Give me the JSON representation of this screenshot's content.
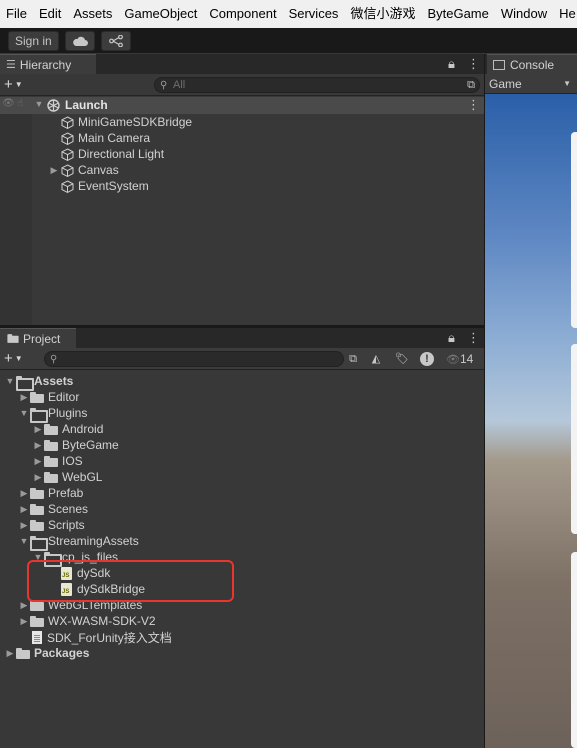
{
  "menu": [
    "File",
    "Edit",
    "Assets",
    "GameObject",
    "Component",
    "Services",
    "微信小游戏",
    "ByteGame",
    "Window",
    "He"
  ],
  "toolbar": {
    "signin": "Sign in",
    "cloud_icon": "cloud-icon",
    "collab_icon": "collab-icon"
  },
  "hierarchy": {
    "tab": "Hierarchy",
    "search_placeholder": "All",
    "scene": "Launch",
    "items": [
      {
        "label": "MiniGameSDKBridge",
        "has_children": false
      },
      {
        "label": "Main Camera",
        "has_children": false
      },
      {
        "label": "Directional Light",
        "has_children": false
      },
      {
        "label": "Canvas",
        "has_children": true
      },
      {
        "label": "EventSystem",
        "has_children": false
      }
    ]
  },
  "project": {
    "tab": "Project",
    "hidden_count": "14",
    "tree": {
      "assets": "Assets",
      "editor": "Editor",
      "plugins": "Plugins",
      "android": "Android",
      "bytegame": "ByteGame",
      "ios": "IOS",
      "webgl": "WebGL",
      "prefab": "Prefab",
      "scenes": "Scenes",
      "scripts": "Scripts",
      "streaming": "StreamingAssets",
      "cp_files": "cp_js_files",
      "dysdk": "dySdk",
      "dysdkbridge": "dySdkBridge",
      "webgltemplates": "WebGLTemplates",
      "wxsdk": "WX-WASM-SDK-V2",
      "doc": "SDK_ForUnity接入文档",
      "packages": "Packages"
    }
  },
  "right": {
    "console_tab": "Console",
    "game_select": "Game"
  },
  "colors": {
    "highlight": "#e6362d",
    "panel_bg": "#383838",
    "menubar_bg": "#f0f0f0"
  }
}
